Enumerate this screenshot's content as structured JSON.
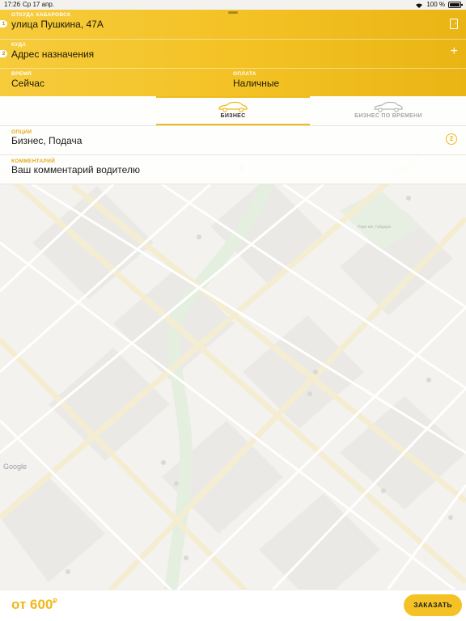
{
  "status_bar": {
    "time": "17:26",
    "date": "Ср 17 апр.",
    "battery": "100 %"
  },
  "header": {
    "from_label": "ОТКУДА",
    "from_city": "ХАБАРОВСК",
    "from_index": "1",
    "from_value": "улица Пушкина, 47А",
    "to_label": "КУДА",
    "to_index": "2",
    "to_value": "Адрес назначения",
    "time_label": "ВРЕМЯ",
    "time_value": "Сейчас",
    "payment_label": "ОПЛАТА",
    "payment_value": "Наличные",
    "plus": "+"
  },
  "tabs": [
    {
      "label": "БИЗНЕС",
      "selected": true
    },
    {
      "label": "БИЗНЕС ПО ВРЕМЕНИ",
      "selected": false
    }
  ],
  "options": {
    "label": "ОПЦИИ",
    "value": "Бизнес, Подача",
    "count": "2"
  },
  "comment": {
    "label": "КОММЕНТАРИЙ",
    "placeholder": "Ваш комментарий водителю"
  },
  "bottom": {
    "price_prefix": "от",
    "price": "600",
    "currency": "₽",
    "order_label": "ЗАКАЗАТЬ"
  },
  "map": {
    "google": "Google",
    "park_label": "Парк им. Гайдара"
  },
  "colors": {
    "accent": "#f3c123",
    "accent_text": "#f0b81a"
  }
}
